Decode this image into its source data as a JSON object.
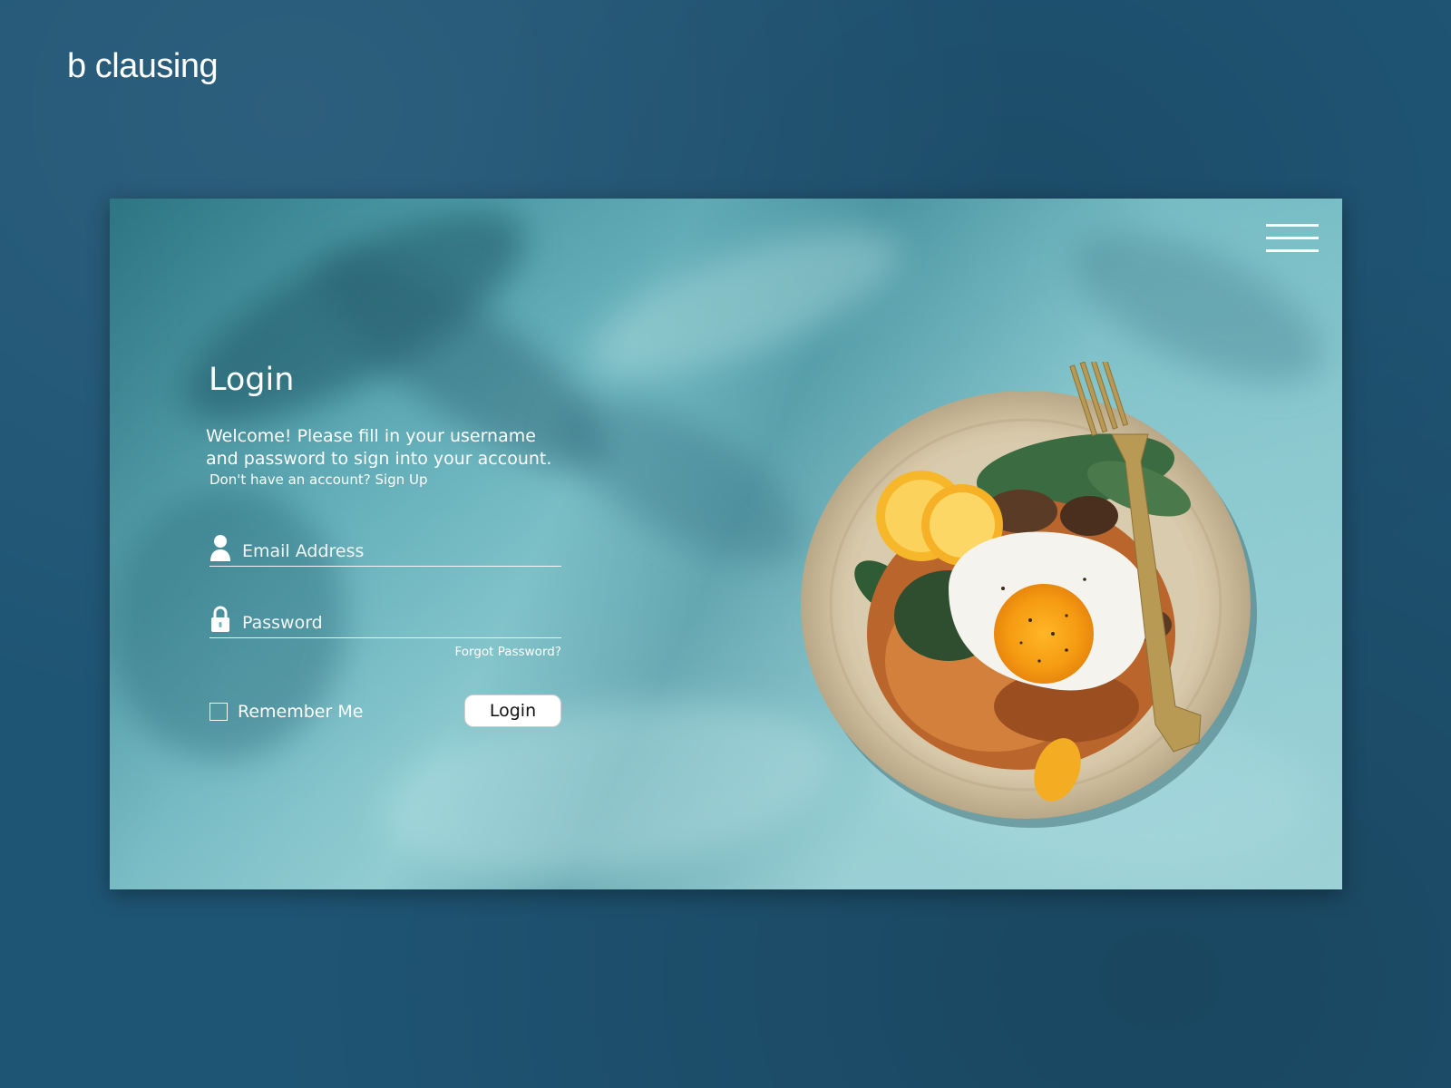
{
  "brand": {
    "name": "b clausing"
  },
  "header": {
    "menu_icon": "hamburger-menu-icon"
  },
  "login": {
    "title": "Login",
    "welcome_line_1": "Welcome! Please fill in your username",
    "welcome_line_2": "and password to sign into your account.",
    "signup_prompt": "Don't have an account? Sign Up",
    "email": {
      "icon": "user-icon",
      "placeholder": "Email Address",
      "value": ""
    },
    "password": {
      "icon": "lock-icon",
      "placeholder": "Password",
      "value": ""
    },
    "forgot_label": "Forgot Password?",
    "remember_label": "Remember Me",
    "remember_checked": false,
    "submit_label": "Login"
  },
  "hero_image": {
    "description_icon": "food-bowl-photo"
  },
  "colors": {
    "page_background": "#1f5574",
    "card_teal": "#6eb7c0",
    "text": "#ffffff",
    "button_background": "#ffffff"
  }
}
